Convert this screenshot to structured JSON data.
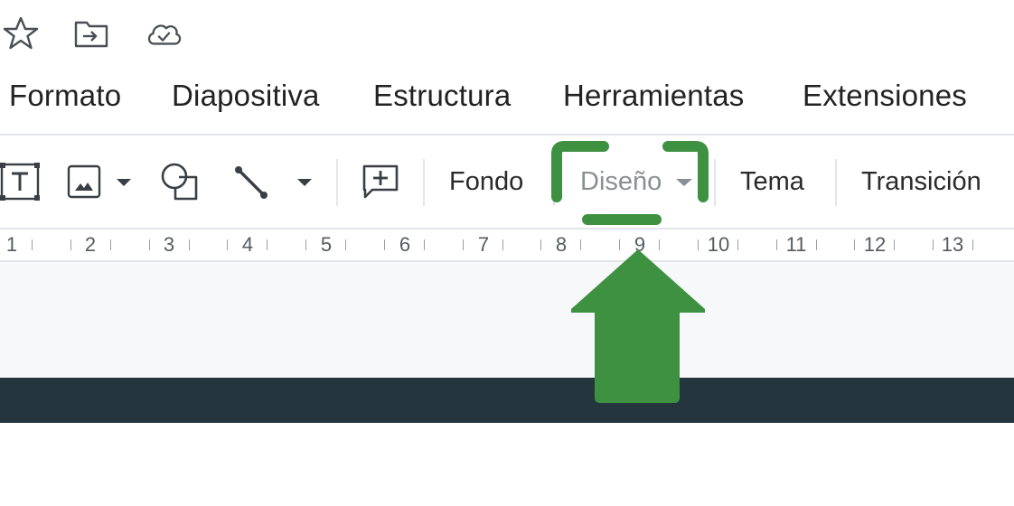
{
  "top_icons": [
    {
      "name": "star-icon"
    },
    {
      "name": "move-to-folder-icon"
    },
    {
      "name": "cloud-saved-icon"
    }
  ],
  "menu": {
    "items": [
      "Formato",
      "Diapositiva",
      "Estructura",
      "Herramientas",
      "Extensiones"
    ]
  },
  "toolbar": {
    "fondo_label": "Fondo",
    "diseno_label": "Diseño",
    "tema_label": "Tema",
    "transicion_label": "Transición"
  },
  "ruler": {
    "labels": [
      "1",
      "2",
      "3",
      "4",
      "5",
      "6",
      "7",
      "8",
      "9",
      "10",
      "11",
      "12",
      "13"
    ]
  },
  "colors": {
    "annotation_green": "#3d9140",
    "slide_strip": "#25353d",
    "canvas_gray": "#f7f8fa"
  }
}
